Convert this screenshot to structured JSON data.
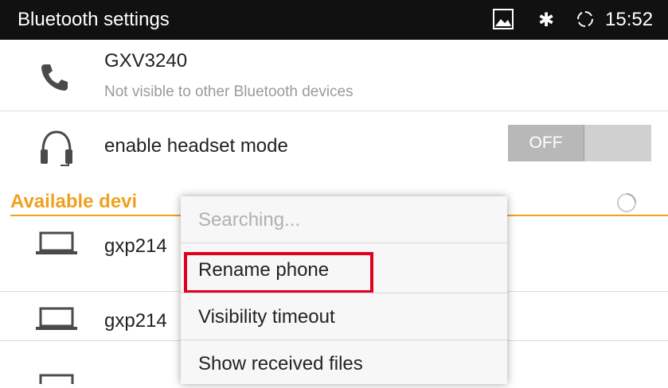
{
  "status_bar": {
    "title": "Bluetooth settings",
    "time": "15:52",
    "icons": [
      "image-icon",
      "bluetooth-icon",
      "sync-icon"
    ]
  },
  "device": {
    "name": "GXV3240",
    "visibility": "Not visible to other Bluetooth devices",
    "icon": "phone-icon"
  },
  "headset": {
    "label": "enable headset mode",
    "toggle_label": "OFF",
    "icon": "headset-icon"
  },
  "available": {
    "header": "Available devi",
    "devices": [
      {
        "name": "gxp214",
        "icon": "laptop-icon"
      },
      {
        "name": "gxp214",
        "icon": "laptop-icon"
      }
    ]
  },
  "menu": {
    "items": [
      {
        "label": "Searching...",
        "enabled": false
      },
      {
        "label": "Rename phone",
        "enabled": true,
        "highlighted": true
      },
      {
        "label": "Visibility timeout",
        "enabled": true
      },
      {
        "label": "Show received files",
        "enabled": true
      }
    ]
  },
  "colors": {
    "accent": "#f0a020",
    "highlight_border": "#e0001b",
    "status_bar": "#111111"
  }
}
